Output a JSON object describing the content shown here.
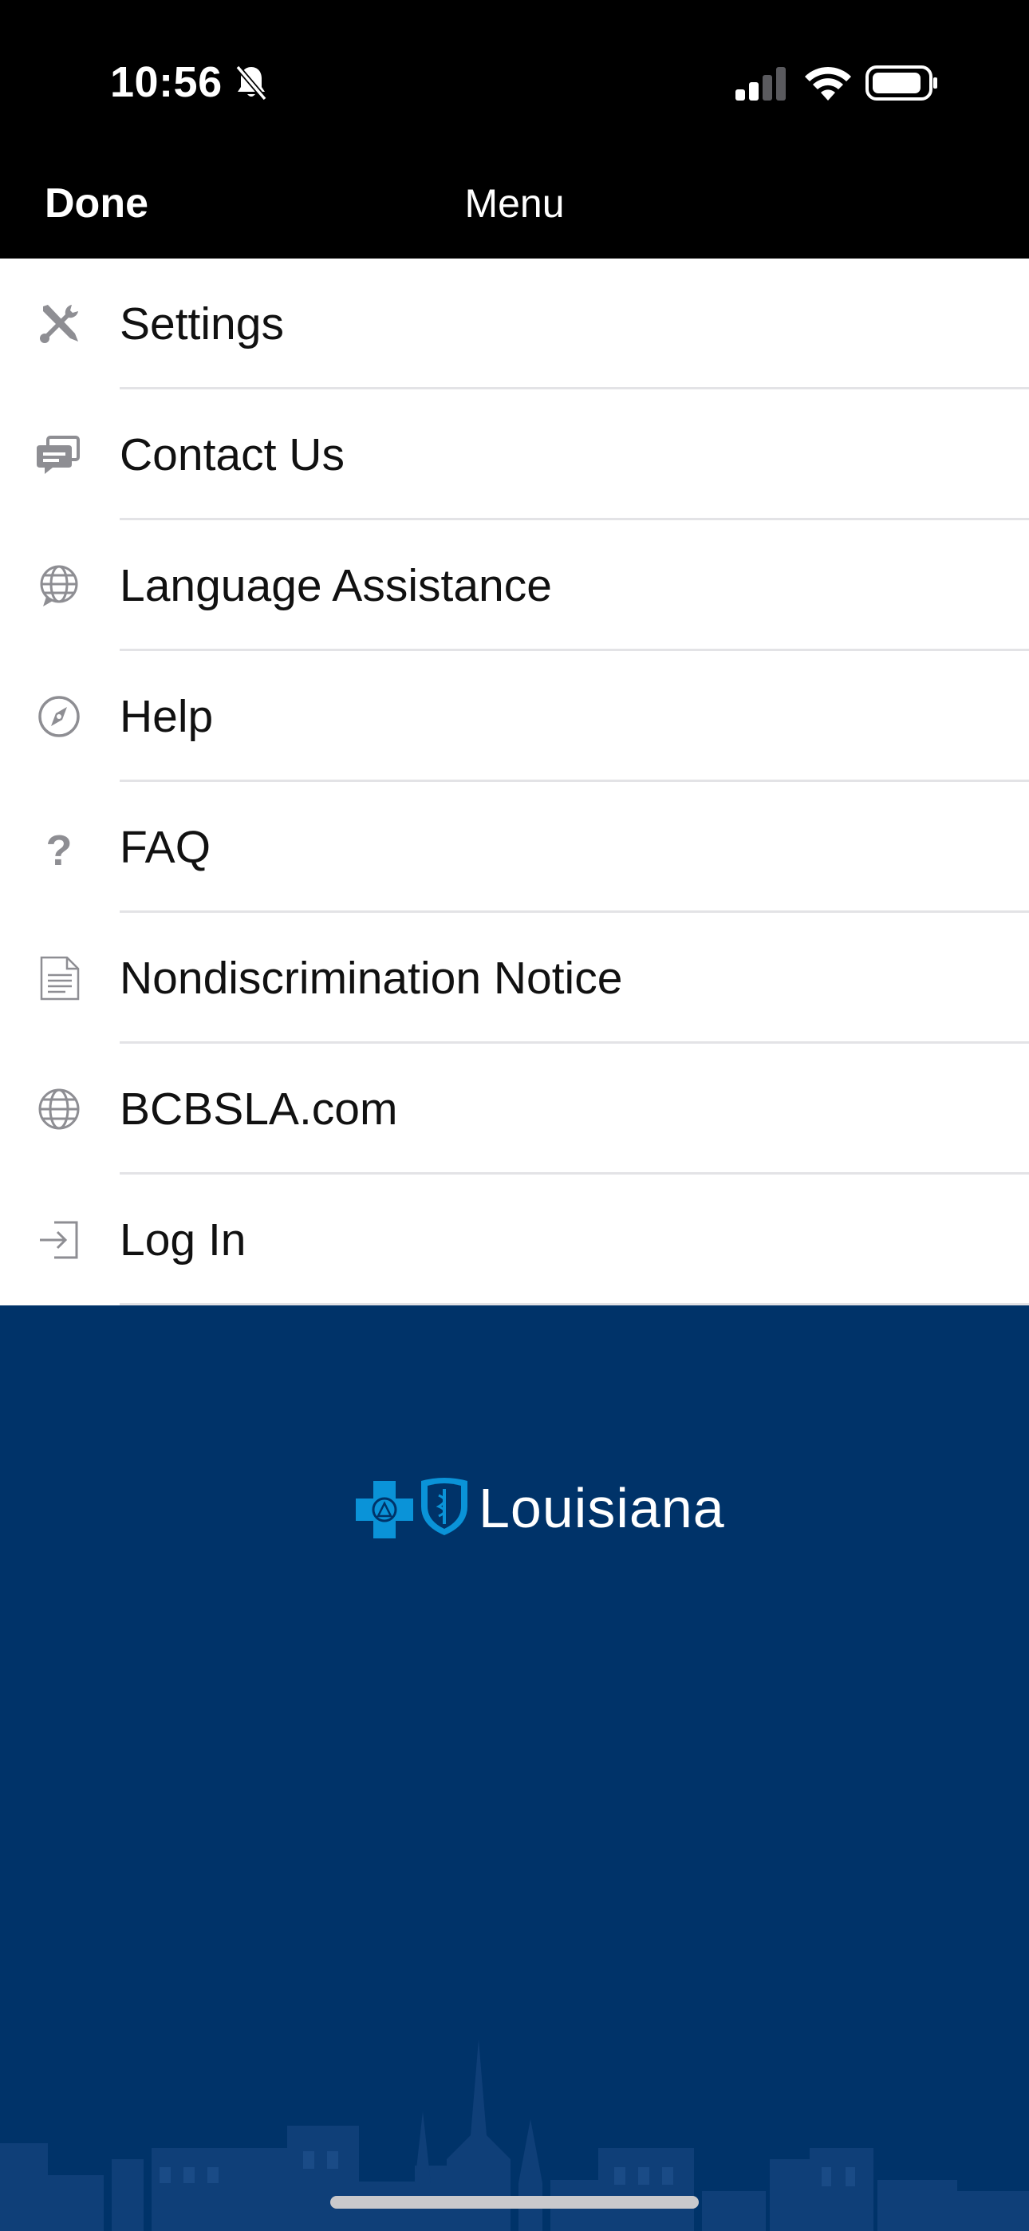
{
  "status_bar": {
    "time": "10:56"
  },
  "nav": {
    "done_label": "Done",
    "title": "Menu"
  },
  "menu": {
    "items": [
      {
        "label": "Settings",
        "icon": "wrench-screwdriver-icon"
      },
      {
        "label": "Contact Us",
        "icon": "chat-bubble-icon"
      },
      {
        "label": "Language Assistance",
        "icon": "globe-speech-icon"
      },
      {
        "label": "Help",
        "icon": "compass-icon"
      },
      {
        "label": "FAQ",
        "icon": "question-mark-icon"
      },
      {
        "label": "Nondiscrimination Notice",
        "icon": "document-icon"
      },
      {
        "label": "BCBSLA.com",
        "icon": "globe-icon"
      },
      {
        "label": "Log In",
        "icon": "login-arrow-icon"
      }
    ]
  },
  "brand": {
    "logo_text": "Louisiana"
  },
  "colors": {
    "brand_blue": "#003369",
    "logo_cyan": "#0a93d8",
    "icon_gray": "#8e8e93",
    "separator": "#e3e3e6"
  }
}
